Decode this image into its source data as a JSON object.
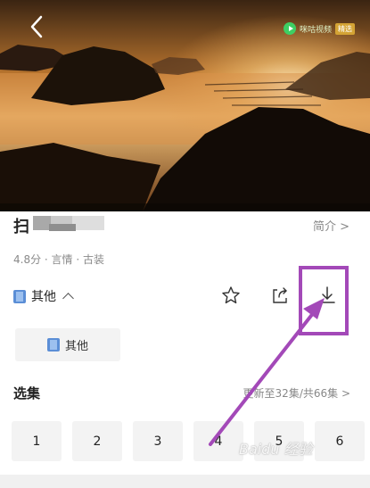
{
  "player": {
    "logo_text": "咪咕视频",
    "logo_badge": "精选"
  },
  "header": {
    "title_visible_char": "扫",
    "intro_link": "简介 >"
  },
  "meta": {
    "info": "4.8分 · 言情 · 古装"
  },
  "source": {
    "current_label": "其他",
    "chip_label": "其他"
  },
  "episodes": {
    "title": "选集",
    "status": "更新至32集/共66集 >",
    "items": [
      "1",
      "2",
      "3",
      "4",
      "5",
      "6"
    ]
  },
  "watermark": "Baidu 经验",
  "colors": {
    "annotation": "#a349b8",
    "film_icon": "#5b8ed6"
  }
}
